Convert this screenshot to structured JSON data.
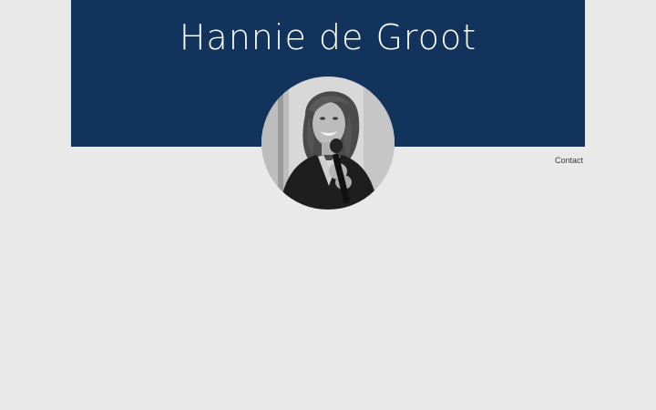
{
  "header": {
    "title": "Hannie de Groot",
    "background_color": "#12335c"
  },
  "avatar": {
    "alt": "Portrait photo (black and white) of Hannie de Groot holding a microphone"
  },
  "nav": {
    "contact_label": "Contact"
  },
  "colors": {
    "page_background": "#e9e9e9",
    "header_background": "#12335c",
    "title_text": "#ffffff"
  }
}
